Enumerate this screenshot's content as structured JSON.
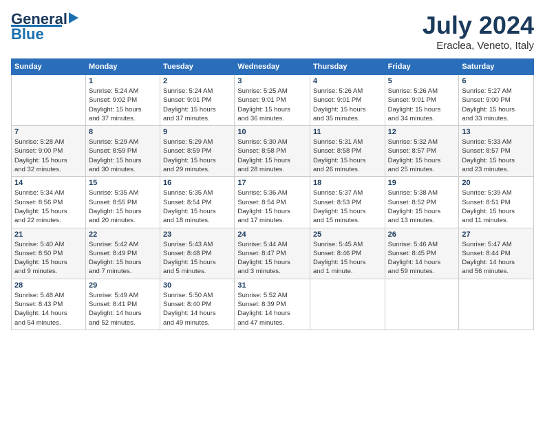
{
  "logo": {
    "line1": "General",
    "line2": "Blue"
  },
  "title": "July 2024",
  "subtitle": "Eraclea, Veneto, Italy",
  "headers": [
    "Sunday",
    "Monday",
    "Tuesday",
    "Wednesday",
    "Thursday",
    "Friday",
    "Saturday"
  ],
  "weeks": [
    [
      {
        "day": "",
        "info": ""
      },
      {
        "day": "1",
        "info": "Sunrise: 5:24 AM\nSunset: 9:02 PM\nDaylight: 15 hours\nand 37 minutes."
      },
      {
        "day": "2",
        "info": "Sunrise: 5:24 AM\nSunset: 9:01 PM\nDaylight: 15 hours\nand 37 minutes."
      },
      {
        "day": "3",
        "info": "Sunrise: 5:25 AM\nSunset: 9:01 PM\nDaylight: 15 hours\nand 36 minutes."
      },
      {
        "day": "4",
        "info": "Sunrise: 5:26 AM\nSunset: 9:01 PM\nDaylight: 15 hours\nand 35 minutes."
      },
      {
        "day": "5",
        "info": "Sunrise: 5:26 AM\nSunset: 9:01 PM\nDaylight: 15 hours\nand 34 minutes."
      },
      {
        "day": "6",
        "info": "Sunrise: 5:27 AM\nSunset: 9:00 PM\nDaylight: 15 hours\nand 33 minutes."
      }
    ],
    [
      {
        "day": "7",
        "info": "Sunrise: 5:28 AM\nSunset: 9:00 PM\nDaylight: 15 hours\nand 32 minutes."
      },
      {
        "day": "8",
        "info": "Sunrise: 5:29 AM\nSunset: 8:59 PM\nDaylight: 15 hours\nand 30 minutes."
      },
      {
        "day": "9",
        "info": "Sunrise: 5:29 AM\nSunset: 8:59 PM\nDaylight: 15 hours\nand 29 minutes."
      },
      {
        "day": "10",
        "info": "Sunrise: 5:30 AM\nSunset: 8:58 PM\nDaylight: 15 hours\nand 28 minutes."
      },
      {
        "day": "11",
        "info": "Sunrise: 5:31 AM\nSunset: 8:58 PM\nDaylight: 15 hours\nand 26 minutes."
      },
      {
        "day": "12",
        "info": "Sunrise: 5:32 AM\nSunset: 8:57 PM\nDaylight: 15 hours\nand 25 minutes."
      },
      {
        "day": "13",
        "info": "Sunrise: 5:33 AM\nSunset: 8:57 PM\nDaylight: 15 hours\nand 23 minutes."
      }
    ],
    [
      {
        "day": "14",
        "info": "Sunrise: 5:34 AM\nSunset: 8:56 PM\nDaylight: 15 hours\nand 22 minutes."
      },
      {
        "day": "15",
        "info": "Sunrise: 5:35 AM\nSunset: 8:55 PM\nDaylight: 15 hours\nand 20 minutes."
      },
      {
        "day": "16",
        "info": "Sunrise: 5:35 AM\nSunset: 8:54 PM\nDaylight: 15 hours\nand 18 minutes."
      },
      {
        "day": "17",
        "info": "Sunrise: 5:36 AM\nSunset: 8:54 PM\nDaylight: 15 hours\nand 17 minutes."
      },
      {
        "day": "18",
        "info": "Sunrise: 5:37 AM\nSunset: 8:53 PM\nDaylight: 15 hours\nand 15 minutes."
      },
      {
        "day": "19",
        "info": "Sunrise: 5:38 AM\nSunset: 8:52 PM\nDaylight: 15 hours\nand 13 minutes."
      },
      {
        "day": "20",
        "info": "Sunrise: 5:39 AM\nSunset: 8:51 PM\nDaylight: 15 hours\nand 11 minutes."
      }
    ],
    [
      {
        "day": "21",
        "info": "Sunrise: 5:40 AM\nSunset: 8:50 PM\nDaylight: 15 hours\nand 9 minutes."
      },
      {
        "day": "22",
        "info": "Sunrise: 5:42 AM\nSunset: 8:49 PM\nDaylight: 15 hours\nand 7 minutes."
      },
      {
        "day": "23",
        "info": "Sunrise: 5:43 AM\nSunset: 8:48 PM\nDaylight: 15 hours\nand 5 minutes."
      },
      {
        "day": "24",
        "info": "Sunrise: 5:44 AM\nSunset: 8:47 PM\nDaylight: 15 hours\nand 3 minutes."
      },
      {
        "day": "25",
        "info": "Sunrise: 5:45 AM\nSunset: 8:46 PM\nDaylight: 15 hours\nand 1 minute."
      },
      {
        "day": "26",
        "info": "Sunrise: 5:46 AM\nSunset: 8:45 PM\nDaylight: 14 hours\nand 59 minutes."
      },
      {
        "day": "27",
        "info": "Sunrise: 5:47 AM\nSunset: 8:44 PM\nDaylight: 14 hours\nand 56 minutes."
      }
    ],
    [
      {
        "day": "28",
        "info": "Sunrise: 5:48 AM\nSunset: 8:43 PM\nDaylight: 14 hours\nand 54 minutes."
      },
      {
        "day": "29",
        "info": "Sunrise: 5:49 AM\nSunset: 8:41 PM\nDaylight: 14 hours\nand 52 minutes."
      },
      {
        "day": "30",
        "info": "Sunrise: 5:50 AM\nSunset: 8:40 PM\nDaylight: 14 hours\nand 49 minutes."
      },
      {
        "day": "31",
        "info": "Sunrise: 5:52 AM\nSunset: 8:39 PM\nDaylight: 14 hours\nand 47 minutes."
      },
      {
        "day": "",
        "info": ""
      },
      {
        "day": "",
        "info": ""
      },
      {
        "day": "",
        "info": ""
      }
    ]
  ]
}
